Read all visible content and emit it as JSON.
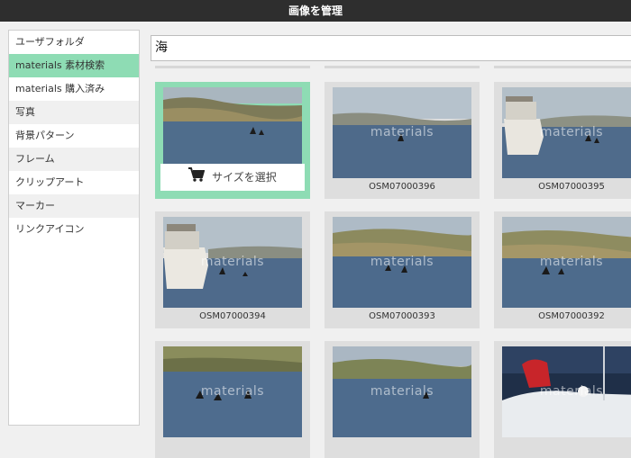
{
  "window": {
    "title": "画像を管理"
  },
  "sidebar": {
    "items": [
      {
        "label": "ユーザフォルダ"
      },
      {
        "label": "materials 素材検索"
      },
      {
        "label": "materials 購入済み"
      },
      {
        "label": "写真"
      },
      {
        "label": "背景パターン"
      },
      {
        "label": "フレーム"
      },
      {
        "label": "クリップアート"
      },
      {
        "label": "マーカー"
      },
      {
        "label": "リンクアイコン"
      }
    ],
    "active_index": 1
  },
  "search": {
    "value": "海"
  },
  "grid": {
    "select_size_label": "サイズを選択",
    "watermark": "materials",
    "items": [
      {
        "caption": ""
      },
      {
        "caption": "OSM07000396"
      },
      {
        "caption": "OSM07000395"
      },
      {
        "caption": "OSM07000394"
      },
      {
        "caption": "OSM07000393"
      },
      {
        "caption": "OSM07000392"
      },
      {
        "caption": ""
      },
      {
        "caption": ""
      },
      {
        "caption": ""
      }
    ]
  },
  "colors": {
    "accent": "#8edcb4",
    "titlebar": "#2e2e2e"
  }
}
